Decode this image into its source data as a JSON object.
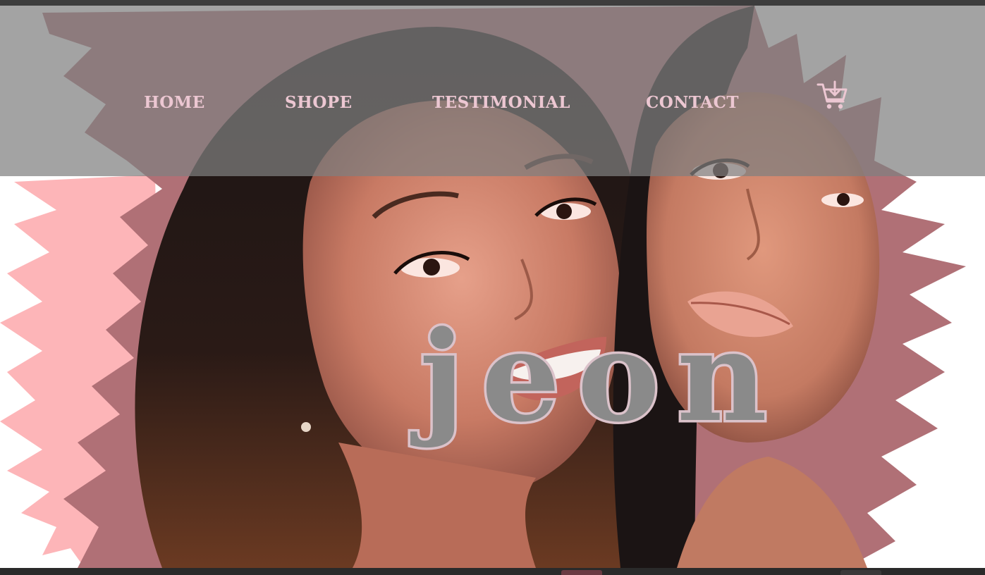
{
  "nav": {
    "items": [
      {
        "label": "HOME"
      },
      {
        "label": "SHOPE"
      },
      {
        "label": "TESTIMONIAL"
      },
      {
        "label": "CONTACT"
      }
    ],
    "cart_icon": "shopping-cart-add-icon"
  },
  "hero": {
    "brand_name": "jeon",
    "image": "two-women-smiling-portrait"
  },
  "colors": {
    "nav_overlay": "#808080",
    "nav_text": "#ecc7d2",
    "brand_fill": "#8a8a8a",
    "brand_outline": "#dbc2ca",
    "accent_pink": "#fdb5b8",
    "mauve": "#b07076"
  }
}
